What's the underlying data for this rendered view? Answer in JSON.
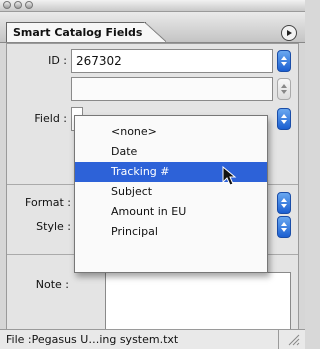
{
  "window": {
    "buttons": [
      "close",
      "minimize",
      "zoom"
    ]
  },
  "tab": {
    "label": "Smart Catalog Fields"
  },
  "fields": {
    "id_label": "ID :",
    "id_value": "267302",
    "field_label": "Field :",
    "format_label": "Format :",
    "style_label": "Style :",
    "note_label": "Note :"
  },
  "popup": {
    "items": [
      "<none>",
      "Date",
      "Tracking #",
      "Subject",
      "Amount in EU",
      "Principal"
    ],
    "selected": "Tracking #"
  },
  "status": {
    "text": "File :Pegasus U…ing system.txt"
  },
  "colors": {
    "selection": "#2d62d8",
    "stepper": "#1b5fd1"
  }
}
